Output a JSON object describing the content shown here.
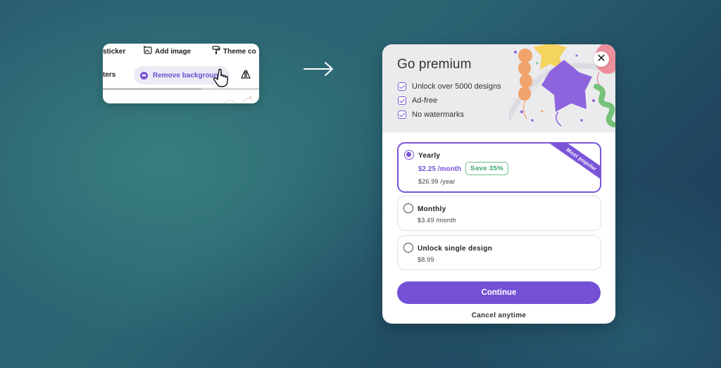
{
  "toolbar": {
    "row1": {
      "sticker_label": "sticker",
      "add_image_label": "Add image",
      "theme_label": "Theme co"
    },
    "row2": {
      "filters_label": "ters",
      "remove_background_label": "Remove background"
    }
  },
  "modal": {
    "title": "Go premium",
    "features": [
      "Unlock over 5000 designs",
      "Ad-free",
      "No watermarks"
    ],
    "close_symbol": "✕",
    "plans": [
      {
        "name": "Yearly",
        "monthly_price": "$2.25 /month",
        "badge": "Save 35%",
        "price": "$26.99 /year",
        "ribbon": "Most popular",
        "selected": true
      },
      {
        "name": "Monthly",
        "price": "$3.49 /month",
        "selected": false
      },
      {
        "name": "Unlock single design",
        "price": "$8.99",
        "selected": false
      }
    ],
    "continue_label": "Continue",
    "cancel_text": "Cancel anytime"
  },
  "colors": {
    "accent": "#7450d6",
    "save_green": "#3aa563",
    "header_bg": "#ebebee"
  },
  "icons": [
    "sticker-icon",
    "add-image-icon",
    "theme-icon",
    "crown-icon",
    "mirror-icon",
    "hand-cursor-icon",
    "arrow-right-icon",
    "check-icon",
    "close-icon",
    "radio-icon"
  ]
}
